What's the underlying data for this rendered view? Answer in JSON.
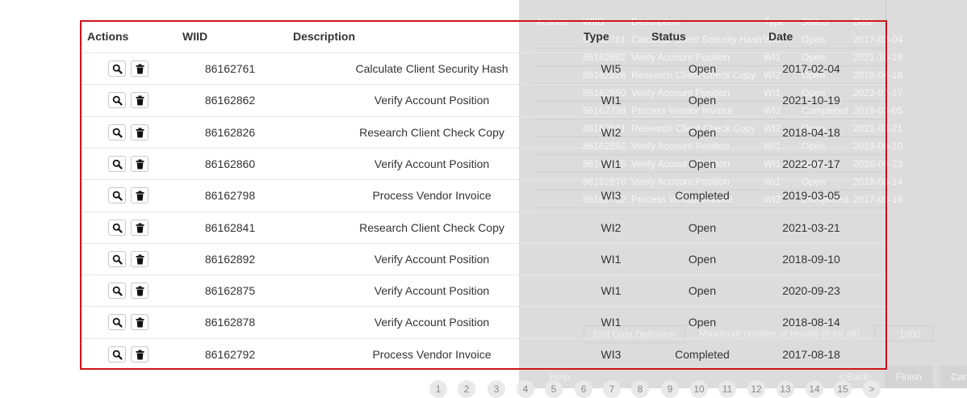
{
  "background": {
    "headers": [
      "Actions",
      "WIID",
      "Description",
      "Type",
      "Status",
      "Date"
    ],
    "rows": [
      {
        "id": "86162761",
        "desc": "Calculate Client Security Hash",
        "type": "WI5",
        "status": "Open",
        "date": "2017-02-04"
      },
      {
        "id": "86162862",
        "desc": "Verify Account Position",
        "type": "WI1",
        "status": "Open",
        "date": "2021-10-19"
      },
      {
        "id": "86162826",
        "desc": "Research Client Check Copy",
        "type": "WI2",
        "status": "Open",
        "date": "2018-04-18"
      },
      {
        "id": "86162860",
        "desc": "Verify Account Position",
        "type": "WI1",
        "status": "Open",
        "date": "2022-07-17"
      },
      {
        "id": "86162798",
        "desc": "Process Vendor Invoice",
        "type": "WI3",
        "status": "Completed",
        "date": "2019-03-05"
      },
      {
        "id": "86162841",
        "desc": "Research Client Check Copy",
        "type": "WI2",
        "status": "Open",
        "date": "2021-03-21"
      },
      {
        "id": "86162892",
        "desc": "Verify Account Position",
        "type": "WI1",
        "status": "Open",
        "date": "2018-09-10"
      },
      {
        "id": "86162875",
        "desc": "Verify Account Position",
        "type": "WI1",
        "status": "Open",
        "date": "2020-09-23"
      },
      {
        "id": "86162878",
        "desc": "Verify Account Position",
        "type": "WI1",
        "status": "Open",
        "date": "2018-08-14"
      },
      {
        "id": "86162792",
        "desc": "Process Vendor Invoice",
        "type": "WI3",
        "status": "Completed",
        "date": "2017-08-18"
      }
    ],
    "edit_definition_label": "Edit Data Definition",
    "max_results_label": "Maximum number of results (0 for all)",
    "max_results_value": "1000",
    "help_label": "Help",
    "back_label": "< Back",
    "finish_label": "Finish",
    "cancel_label": "Can"
  },
  "pagination": {
    "pages": [
      "1",
      "2",
      "3",
      "4",
      "5",
      "6",
      "7",
      "8",
      "9",
      "10",
      "11",
      "12",
      "13",
      "14",
      "15",
      ">"
    ]
  },
  "grid": {
    "headers": {
      "actions": "Actions",
      "wiid": "WIID",
      "description": "Description",
      "type": "Type",
      "status": "Status",
      "date": "Date"
    },
    "rows": [
      {
        "wiid": "86162761",
        "description": "Calculate Client Security Hash",
        "type": "WI5",
        "status": "Open",
        "date": "2017-02-04"
      },
      {
        "wiid": "86162862",
        "description": "Verify Account Position",
        "type": "WI1",
        "status": "Open",
        "date": "2021-10-19"
      },
      {
        "wiid": "86162826",
        "description": "Research Client Check Copy",
        "type": "WI2",
        "status": "Open",
        "date": "2018-04-18"
      },
      {
        "wiid": "86162860",
        "description": "Verify Account Position",
        "type": "WI1",
        "status": "Open",
        "date": "2022-07-17"
      },
      {
        "wiid": "86162798",
        "description": "Process Vendor Invoice",
        "type": "WI3",
        "status": "Completed",
        "date": "2019-03-05"
      },
      {
        "wiid": "86162841",
        "description": "Research Client Check Copy",
        "type": "WI2",
        "status": "Open",
        "date": "2021-03-21"
      },
      {
        "wiid": "86162892",
        "description": "Verify Account Position",
        "type": "WI1",
        "status": "Open",
        "date": "2018-09-10"
      },
      {
        "wiid": "86162875",
        "description": "Verify Account Position",
        "type": "WI1",
        "status": "Open",
        "date": "2020-09-23"
      },
      {
        "wiid": "86162878",
        "description": "Verify Account Position",
        "type": "WI1",
        "status": "Open",
        "date": "2018-08-14"
      },
      {
        "wiid": "86162792",
        "description": "Process Vendor Invoice",
        "type": "WI3",
        "status": "Completed",
        "date": "2017-08-18"
      }
    ],
    "row_icons": [
      "search-icon",
      "trash-icon"
    ],
    "highlight_color": "#d0121b"
  }
}
